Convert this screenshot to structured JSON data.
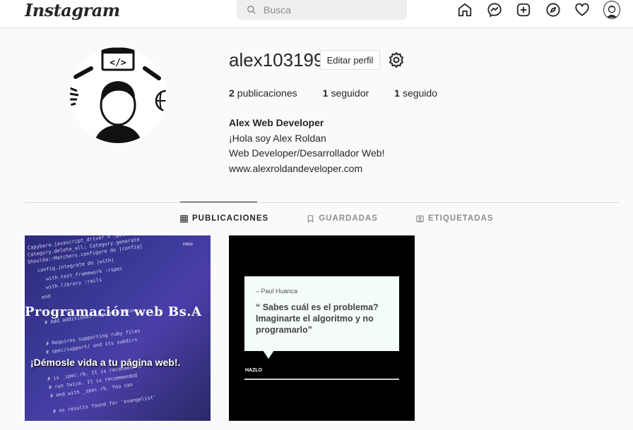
{
  "nav": {
    "logo": "Instagram",
    "search_placeholder": "Busca"
  },
  "profile": {
    "username": "alex103199",
    "edit_button": "Editar perfil",
    "stats": [
      {
        "count": "2",
        "label": "publicaciones"
      },
      {
        "count": "1",
        "label": "seguidor"
      },
      {
        "count": "1",
        "label": "seguido"
      }
    ],
    "bio": {
      "name": "Alex Web Developer",
      "line1": "¡Hola soy Alex Roldan",
      "line2": "Web Developer/Desarrollador Web!",
      "link": "www.alexroldandeveloper.com"
    }
  },
  "tabs": [
    {
      "label": "PUBLICACIONES",
      "active": true,
      "icon": "grid-icon"
    },
    {
      "label": "GUARDADAS",
      "active": false,
      "icon": "bookmark-icon"
    },
    {
      "label": "ETIQUETADAS",
      "active": false,
      "icon": "tagged-icon"
    }
  ],
  "posts": [
    {
      "title": "Programación web Bs.A",
      "subtitle": "¡Démosle vida a tu página web!.",
      "tag": "inicio"
    },
    {
      "author": "– Paul Huanca",
      "quote": "“ Sabes cuál es el problema? Imaginarte el algoritmo y no programarlo”",
      "footer": "HAZLO"
    }
  ],
  "colors": {
    "text": "#262626",
    "muted": "#8e8e8e",
    "border": "#dbdbdb",
    "background": "#fafafa"
  }
}
